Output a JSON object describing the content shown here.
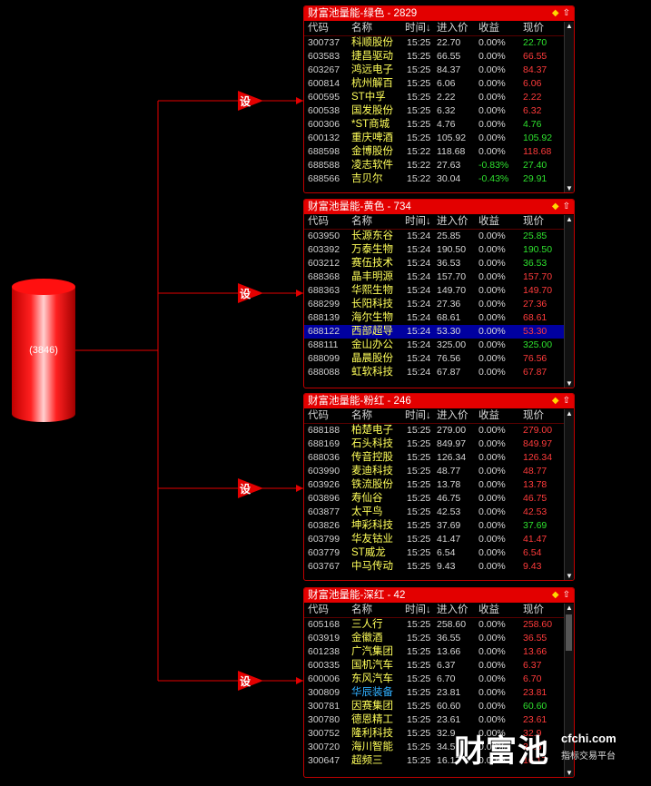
{
  "colors": {
    "accent": "#e30000",
    "up": "#ff3b3b",
    "down": "#2ee02e",
    "flat": "#d8d8d8",
    "name": "#ffff5a",
    "selected": "#0000a0"
  },
  "source": {
    "label": "(3846)"
  },
  "set_label": "设",
  "columns": [
    "代码",
    "名称",
    "时间↓",
    "进入价",
    "收益",
    "现价"
  ],
  "panels": [
    {
      "title": "财富池量能-绿色 - 2829",
      "rows": [
        {
          "code": "300737",
          "name": "科顺股份",
          "time": "15:25",
          "entry": "22.70",
          "gain": "0.00%",
          "price": "22.70",
          "dir": "down"
        },
        {
          "code": "603583",
          "name": "捷昌驱动",
          "time": "15:25",
          "entry": "66.55",
          "gain": "0.00%",
          "price": "66.55",
          "dir": "up"
        },
        {
          "code": "603267",
          "name": "鸿远电子",
          "time": "15:25",
          "entry": "84.37",
          "gain": "0.00%",
          "price": "84.37",
          "dir": "up"
        },
        {
          "code": "600814",
          "name": "杭州解百",
          "time": "15:25",
          "entry": "6.06",
          "gain": "0.00%",
          "price": "6.06",
          "dir": "up"
        },
        {
          "code": "600595",
          "name": "ST中孚",
          "time": "15:25",
          "entry": "2.22",
          "gain": "0.00%",
          "price": "2.22",
          "dir": "up"
        },
        {
          "code": "600538",
          "name": "国发股份",
          "time": "15:25",
          "entry": "6.32",
          "gain": "0.00%",
          "price": "6.32",
          "dir": "up"
        },
        {
          "code": "600306",
          "name": "*ST商城",
          "time": "15:25",
          "entry": "4.76",
          "gain": "0.00%",
          "price": "4.76",
          "dir": "down"
        },
        {
          "code": "600132",
          "name": "重庆啤酒",
          "time": "15:25",
          "entry": "105.92",
          "gain": "0.00%",
          "price": "105.92",
          "dir": "down"
        },
        {
          "code": "688598",
          "name": "金博股份",
          "time": "15:22",
          "entry": "118.68",
          "gain": "0.00%",
          "price": "118.68",
          "dir": "up"
        },
        {
          "code": "688588",
          "name": "凌志软件",
          "time": "15:22",
          "entry": "27.63",
          "gain": "-0.83%",
          "price": "27.40",
          "dir": "down"
        },
        {
          "code": "688566",
          "name": "吉贝尔",
          "time": "15:22",
          "entry": "30.04",
          "gain": "-0.43%",
          "price": "29.91",
          "dir": "down"
        }
      ]
    },
    {
      "title": "财富池量能-黄色 - 734",
      "rows": [
        {
          "code": "603950",
          "name": "长源东谷",
          "time": "15:24",
          "entry": "25.85",
          "gain": "0.00%",
          "price": "25.85",
          "dir": "down"
        },
        {
          "code": "603392",
          "name": "万泰生物",
          "time": "15:24",
          "entry": "190.50",
          "gain": "0.00%",
          "price": "190.50",
          "dir": "down"
        },
        {
          "code": "603212",
          "name": "赛伍技术",
          "time": "15:24",
          "entry": "36.53",
          "gain": "0.00%",
          "price": "36.53",
          "dir": "down"
        },
        {
          "code": "688368",
          "name": "晶丰明源",
          "time": "15:24",
          "entry": "157.70",
          "gain": "0.00%",
          "price": "157.70",
          "dir": "up"
        },
        {
          "code": "688363",
          "name": "华熙生物",
          "time": "15:24",
          "entry": "149.70",
          "gain": "0.00%",
          "price": "149.70",
          "dir": "up"
        },
        {
          "code": "688299",
          "name": "长阳科技",
          "time": "15:24",
          "entry": "27.36",
          "gain": "0.00%",
          "price": "27.36",
          "dir": "up"
        },
        {
          "code": "688139",
          "name": "海尔生物",
          "time": "15:24",
          "entry": "68.61",
          "gain": "0.00%",
          "price": "68.61",
          "dir": "up"
        },
        {
          "code": "688122",
          "name": "西部超导",
          "time": "15:24",
          "entry": "53.30",
          "gain": "0.00%",
          "price": "53.30",
          "dir": "up",
          "selected": true
        },
        {
          "code": "688111",
          "name": "金山办公",
          "time": "15:24",
          "entry": "325.00",
          "gain": "0.00%",
          "price": "325.00",
          "dir": "down"
        },
        {
          "code": "688099",
          "name": "晶晨股份",
          "time": "15:24",
          "entry": "76.56",
          "gain": "0.00%",
          "price": "76.56",
          "dir": "up"
        },
        {
          "code": "688088",
          "name": "虹软科技",
          "time": "15:24",
          "entry": "67.87",
          "gain": "0.00%",
          "price": "67.87",
          "dir": "up"
        }
      ]
    },
    {
      "title": "财富池量能-粉红 - 246",
      "rows": [
        {
          "code": "688188",
          "name": "柏楚电子",
          "time": "15:25",
          "entry": "279.00",
          "gain": "0.00%",
          "price": "279.00",
          "dir": "up"
        },
        {
          "code": "688169",
          "name": "石头科技",
          "time": "15:25",
          "entry": "849.97",
          "gain": "0.00%",
          "price": "849.97",
          "dir": "up"
        },
        {
          "code": "688036",
          "name": "传音控股",
          "time": "15:25",
          "entry": "126.34",
          "gain": "0.00%",
          "price": "126.34",
          "dir": "up"
        },
        {
          "code": "603990",
          "name": "麦迪科技",
          "time": "15:25",
          "entry": "48.77",
          "gain": "0.00%",
          "price": "48.77",
          "dir": "up"
        },
        {
          "code": "603926",
          "name": "铁流股份",
          "time": "15:25",
          "entry": "13.78",
          "gain": "0.00%",
          "price": "13.78",
          "dir": "up"
        },
        {
          "code": "603896",
          "name": "寿仙谷",
          "time": "15:25",
          "entry": "46.75",
          "gain": "0.00%",
          "price": "46.75",
          "dir": "up"
        },
        {
          "code": "603877",
          "name": "太平鸟",
          "time": "15:25",
          "entry": "42.53",
          "gain": "0.00%",
          "price": "42.53",
          "dir": "up"
        },
        {
          "code": "603826",
          "name": "坤彩科技",
          "time": "15:25",
          "entry": "37.69",
          "gain": "0.00%",
          "price": "37.69",
          "dir": "down"
        },
        {
          "code": "603799",
          "name": "华友钴业",
          "time": "15:25",
          "entry": "41.47",
          "gain": "0.00%",
          "price": "41.47",
          "dir": "up"
        },
        {
          "code": "603779",
          "name": "ST威龙",
          "time": "15:25",
          "entry": "6.54",
          "gain": "0.00%",
          "price": "6.54",
          "dir": "up"
        },
        {
          "code": "603767",
          "name": "中马传动",
          "time": "15:25",
          "entry": "9.43",
          "gain": "0.00%",
          "price": "9.43",
          "dir": "up"
        }
      ]
    },
    {
      "title": "财富池量能-深红 - 42",
      "rows": [
        {
          "code": "605168",
          "name": "三人行",
          "time": "15:25",
          "entry": "258.60",
          "gain": "0.00%",
          "price": "258.60",
          "dir": "up"
        },
        {
          "code": "603919",
          "name": "金徽酒",
          "time": "15:25",
          "entry": "36.55",
          "gain": "0.00%",
          "price": "36.55",
          "dir": "up"
        },
        {
          "code": "601238",
          "name": "广汽集团",
          "time": "15:25",
          "entry": "13.66",
          "gain": "0.00%",
          "price": "13.66",
          "dir": "up"
        },
        {
          "code": "600335",
          "name": "国机汽车",
          "time": "15:25",
          "entry": "6.37",
          "gain": "0.00%",
          "price": "6.37",
          "dir": "up"
        },
        {
          "code": "600006",
          "name": "东风汽车",
          "time": "15:25",
          "entry": "6.70",
          "gain": "0.00%",
          "price": "6.70",
          "dir": "up"
        },
        {
          "code": "300809",
          "name": "华辰装备",
          "time": "15:25",
          "entry": "23.81",
          "gain": "0.00%",
          "price": "23.81",
          "dir": "up",
          "name_color": "#30b0ff"
        },
        {
          "code": "300781",
          "name": "因赛集团",
          "time": "15:25",
          "entry": "60.60",
          "gain": "0.00%",
          "price": "60.60",
          "dir": "down"
        },
        {
          "code": "300780",
          "name": "德恩精工",
          "time": "15:25",
          "entry": "23.61",
          "gain": "0.00%",
          "price": "23.61",
          "dir": "up"
        },
        {
          "code": "300752",
          "name": "隆利科技",
          "time": "15:25",
          "entry": "32.9",
          "gain": "0.00%",
          "price": "32.9",
          "dir": "up"
        },
        {
          "code": "300720",
          "name": "海川智能",
          "time": "15:25",
          "entry": "34.5",
          "gain": "0.00%",
          "price": "34.5",
          "dir": "up"
        },
        {
          "code": "300647",
          "name": "超频三",
          "time": "15:25",
          "entry": "16.17",
          "gain": "0.00%",
          "price": "16.17",
          "dir": "up"
        }
      ]
    }
  ],
  "watermark": {
    "brand": "财富池",
    "url": "cfchi.com",
    "tagline": "指标交易平台"
  }
}
